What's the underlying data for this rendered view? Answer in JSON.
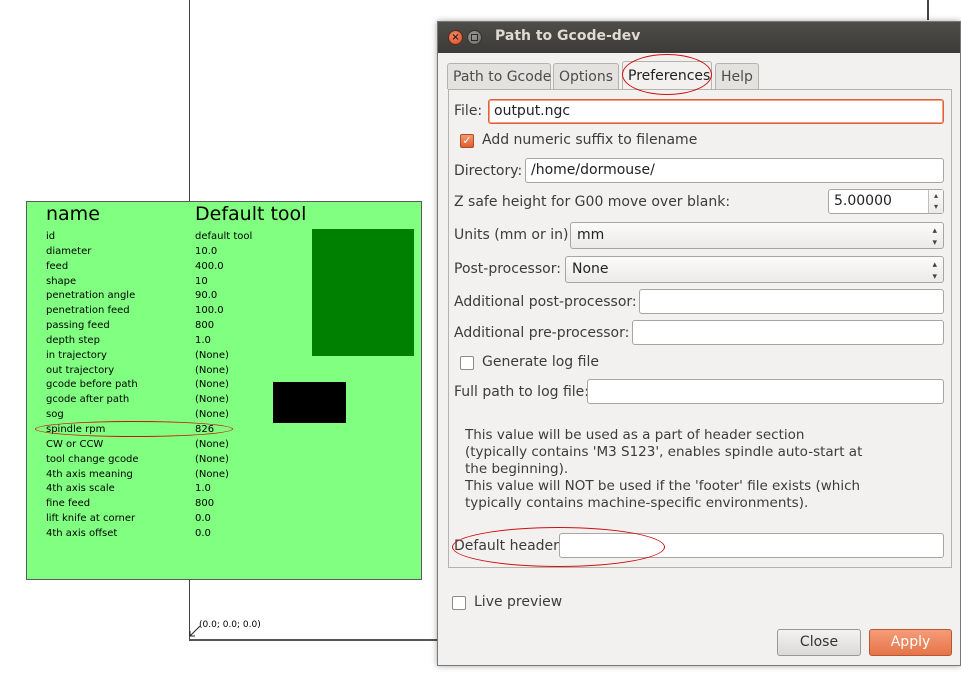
{
  "canvas": {
    "origin_label": "(0.0; 0.0; 0.0)",
    "tool_table": {
      "header_name": "name",
      "header_tool": "Default tool",
      "rows": [
        {
          "key": "id",
          "value": "default tool"
        },
        {
          "key": "diameter",
          "value": "10.0"
        },
        {
          "key": "feed",
          "value": "400.0"
        },
        {
          "key": "shape",
          "value": "10"
        },
        {
          "key": "penetration angle",
          "value": "90.0"
        },
        {
          "key": "penetration feed",
          "value": "100.0"
        },
        {
          "key": "passing feed",
          "value": "800"
        },
        {
          "key": "depth step",
          "value": "1.0"
        },
        {
          "key": "in trajectory",
          "value": "(None)"
        },
        {
          "key": "out trajectory",
          "value": "(None)"
        },
        {
          "key": "gcode before path",
          "value": "(None)"
        },
        {
          "key": "gcode after path",
          "value": "(None)"
        },
        {
          "key": "sog",
          "value": "(None)"
        },
        {
          "key": "spindle rpm",
          "value": "826"
        },
        {
          "key": "CW or CCW",
          "value": "(None)"
        },
        {
          "key": "tool change gcode",
          "value": "(None)"
        },
        {
          "key": "4th axis meaning",
          "value": "(None)"
        },
        {
          "key": "4th axis scale",
          "value": "1.0"
        },
        {
          "key": "fine feed",
          "value": "800"
        },
        {
          "key": "lift knife at corner",
          "value": "0.0"
        },
        {
          "key": "4th axis offset",
          "value": "0.0"
        }
      ]
    }
  },
  "dialog": {
    "title": "Path to Gcode-dev",
    "tabs": [
      "Path to Gcode",
      "Options",
      "Preferences",
      "Help"
    ],
    "active_tab": "Preferences",
    "file_label": "File:",
    "file_value": "output.ngc",
    "suffix_label": "Add numeric suffix to filename",
    "suffix_checked": true,
    "directory_label": "Directory:",
    "directory_value": "/home/dormouse/",
    "zsafe_label": "Z safe height for G00 move over blank:",
    "zsafe_value": "5.00000",
    "units_label": "Units (mm or in):",
    "units_value": "mm",
    "postproc_label": "Post-processor:",
    "postproc_value": "None",
    "add_post_label": "Additional post-processor:",
    "add_post_value": "",
    "add_pre_label": "Additional pre-processor:",
    "add_pre_value": "",
    "log_label": "Generate log file",
    "log_checked": false,
    "logpath_label": "Full path to log file:",
    "logpath_value": "",
    "info_lines": [
      "This value will be used as a part of header section",
      "(typically contains 'M3 S123', enables spindle auto-start at",
      "the beginning).",
      "This value will NOT be used if the 'footer' file exists (which",
      "typically contains machine-specific environments)."
    ],
    "header_label": "Default header",
    "header_value": "",
    "live_preview_label": "Live preview",
    "live_preview_checked": false,
    "close_label": "Close",
    "apply_label": "Apply"
  },
  "colors": {
    "tool_panel_bg": "#80ff80",
    "accent": "#e6744a",
    "annotation_red": "#d01010"
  }
}
